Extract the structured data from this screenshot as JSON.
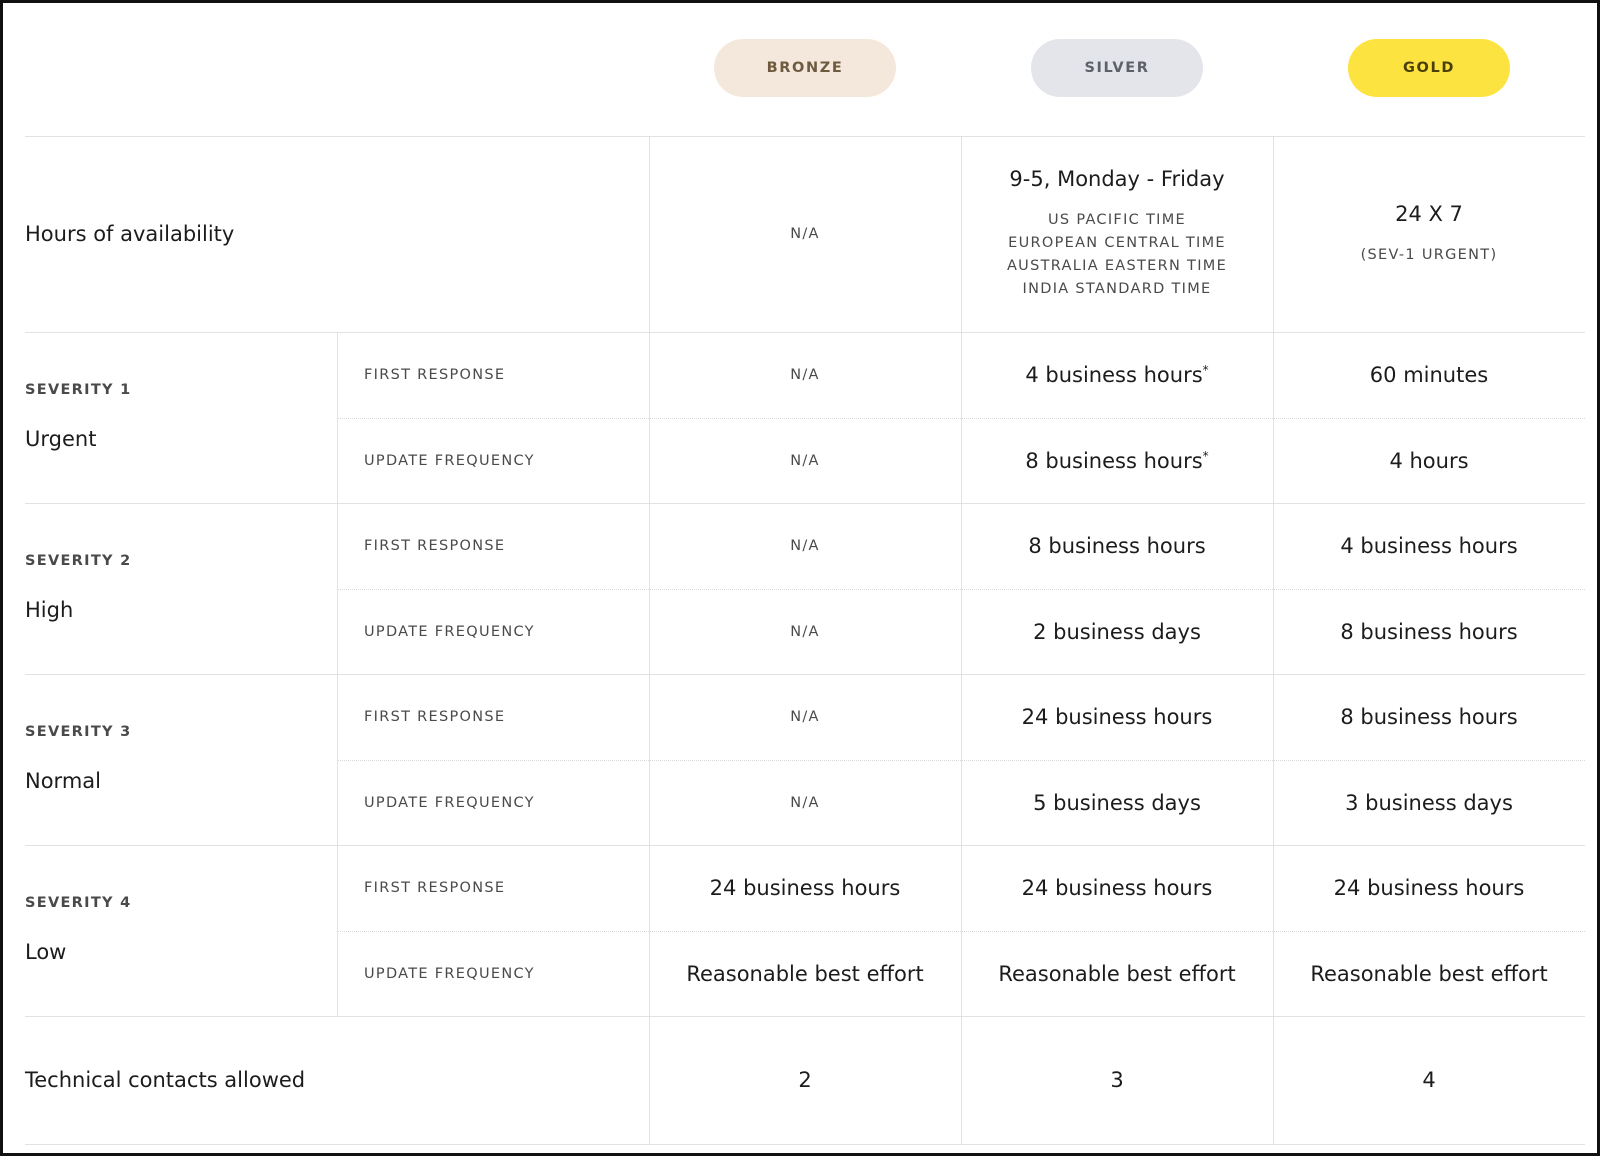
{
  "tiers": {
    "bronze": "BRONZE",
    "silver": "SILVER",
    "gold": "GOLD"
  },
  "availability": {
    "label": "Hours of availability",
    "bronze": "N/A",
    "silver_main": "9-5, Monday - Friday",
    "silver_zones": [
      "US PACIFIC TIME",
      "EUROPEAN CENTRAL TIME",
      "AUSTRALIA EASTERN TIME",
      "INDIA STANDARD TIME"
    ],
    "gold_main": "24 X 7",
    "gold_sub": "(SEV-1 URGENT)"
  },
  "metrics": {
    "first_response": "FIRST RESPONSE",
    "update_frequency": "UPDATE FREQUENCY"
  },
  "severities": [
    {
      "kicker": "SEVERITY 1",
      "name": "Urgent",
      "first_response": {
        "bronze": "N/A",
        "silver": "4 business hours",
        "silver_mark": "*",
        "gold": "60 minutes"
      },
      "update_frequency": {
        "bronze": "N/A",
        "silver": "8 business hours",
        "silver_mark": "*",
        "gold": "4 hours"
      }
    },
    {
      "kicker": "SEVERITY 2",
      "name": "High",
      "first_response": {
        "bronze": "N/A",
        "silver": "8 business hours",
        "gold": "4 business hours"
      },
      "update_frequency": {
        "bronze": "N/A",
        "silver": "2 business days",
        "gold": "8 business hours"
      }
    },
    {
      "kicker": "SEVERITY 3",
      "name": "Normal",
      "first_response": {
        "bronze": "N/A",
        "silver": "24 business hours",
        "gold": "8 business hours"
      },
      "update_frequency": {
        "bronze": "N/A",
        "silver": "5 business days",
        "gold": "3 business days"
      }
    },
    {
      "kicker": "SEVERITY 4",
      "name": "Low",
      "first_response": {
        "bronze": "24 business hours",
        "silver": "24 business hours",
        "gold": "24 business hours"
      },
      "update_frequency": {
        "bronze": "Reasonable best effort",
        "silver": "Reasonable best effort",
        "gold": "Reasonable best effort"
      }
    }
  ],
  "contacts": {
    "label": "Technical contacts allowed",
    "bronze": "2",
    "silver": "3",
    "gold": "4"
  }
}
